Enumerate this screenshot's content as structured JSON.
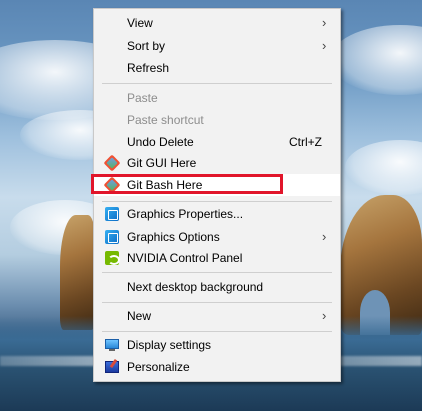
{
  "menu": {
    "items": [
      {
        "label": "View",
        "submenu": true,
        "disabled": false
      },
      {
        "label": "Sort by",
        "submenu": true,
        "disabled": false
      },
      {
        "label": "Refresh",
        "submenu": false,
        "disabled": false
      },
      {
        "label": "Paste",
        "submenu": false,
        "disabled": true
      },
      {
        "label": "Paste shortcut",
        "submenu": false,
        "disabled": true
      },
      {
        "label": "Undo Delete",
        "shortcut": "Ctrl+Z",
        "submenu": false,
        "disabled": false
      },
      {
        "label": "Git GUI Here",
        "icon": "git-icon",
        "submenu": false,
        "disabled": false
      },
      {
        "label": "Git Bash Here",
        "icon": "git-icon",
        "submenu": false,
        "disabled": false,
        "highlighted": true
      },
      {
        "label": "Graphics Properties...",
        "icon": "intel-graphics-icon",
        "submenu": false,
        "disabled": false
      },
      {
        "label": "Graphics Options",
        "icon": "intel-graphics-icon",
        "submenu": true,
        "disabled": false
      },
      {
        "label": "NVIDIA Control Panel",
        "icon": "nvidia-icon",
        "submenu": false,
        "disabled": false
      },
      {
        "label": "Next desktop background",
        "submenu": false,
        "disabled": false
      },
      {
        "label": "New",
        "submenu": true,
        "disabled": false
      },
      {
        "label": "Display settings",
        "icon": "display-icon",
        "submenu": false,
        "disabled": false
      },
      {
        "label": "Personalize",
        "icon": "personalize-icon",
        "submenu": false,
        "disabled": false
      }
    ],
    "submenu_arrow": "›"
  },
  "colors": {
    "highlight_border": "#e1152a",
    "menu_bg": "#f2f2f2",
    "disabled_text": "#8d8d8d"
  }
}
